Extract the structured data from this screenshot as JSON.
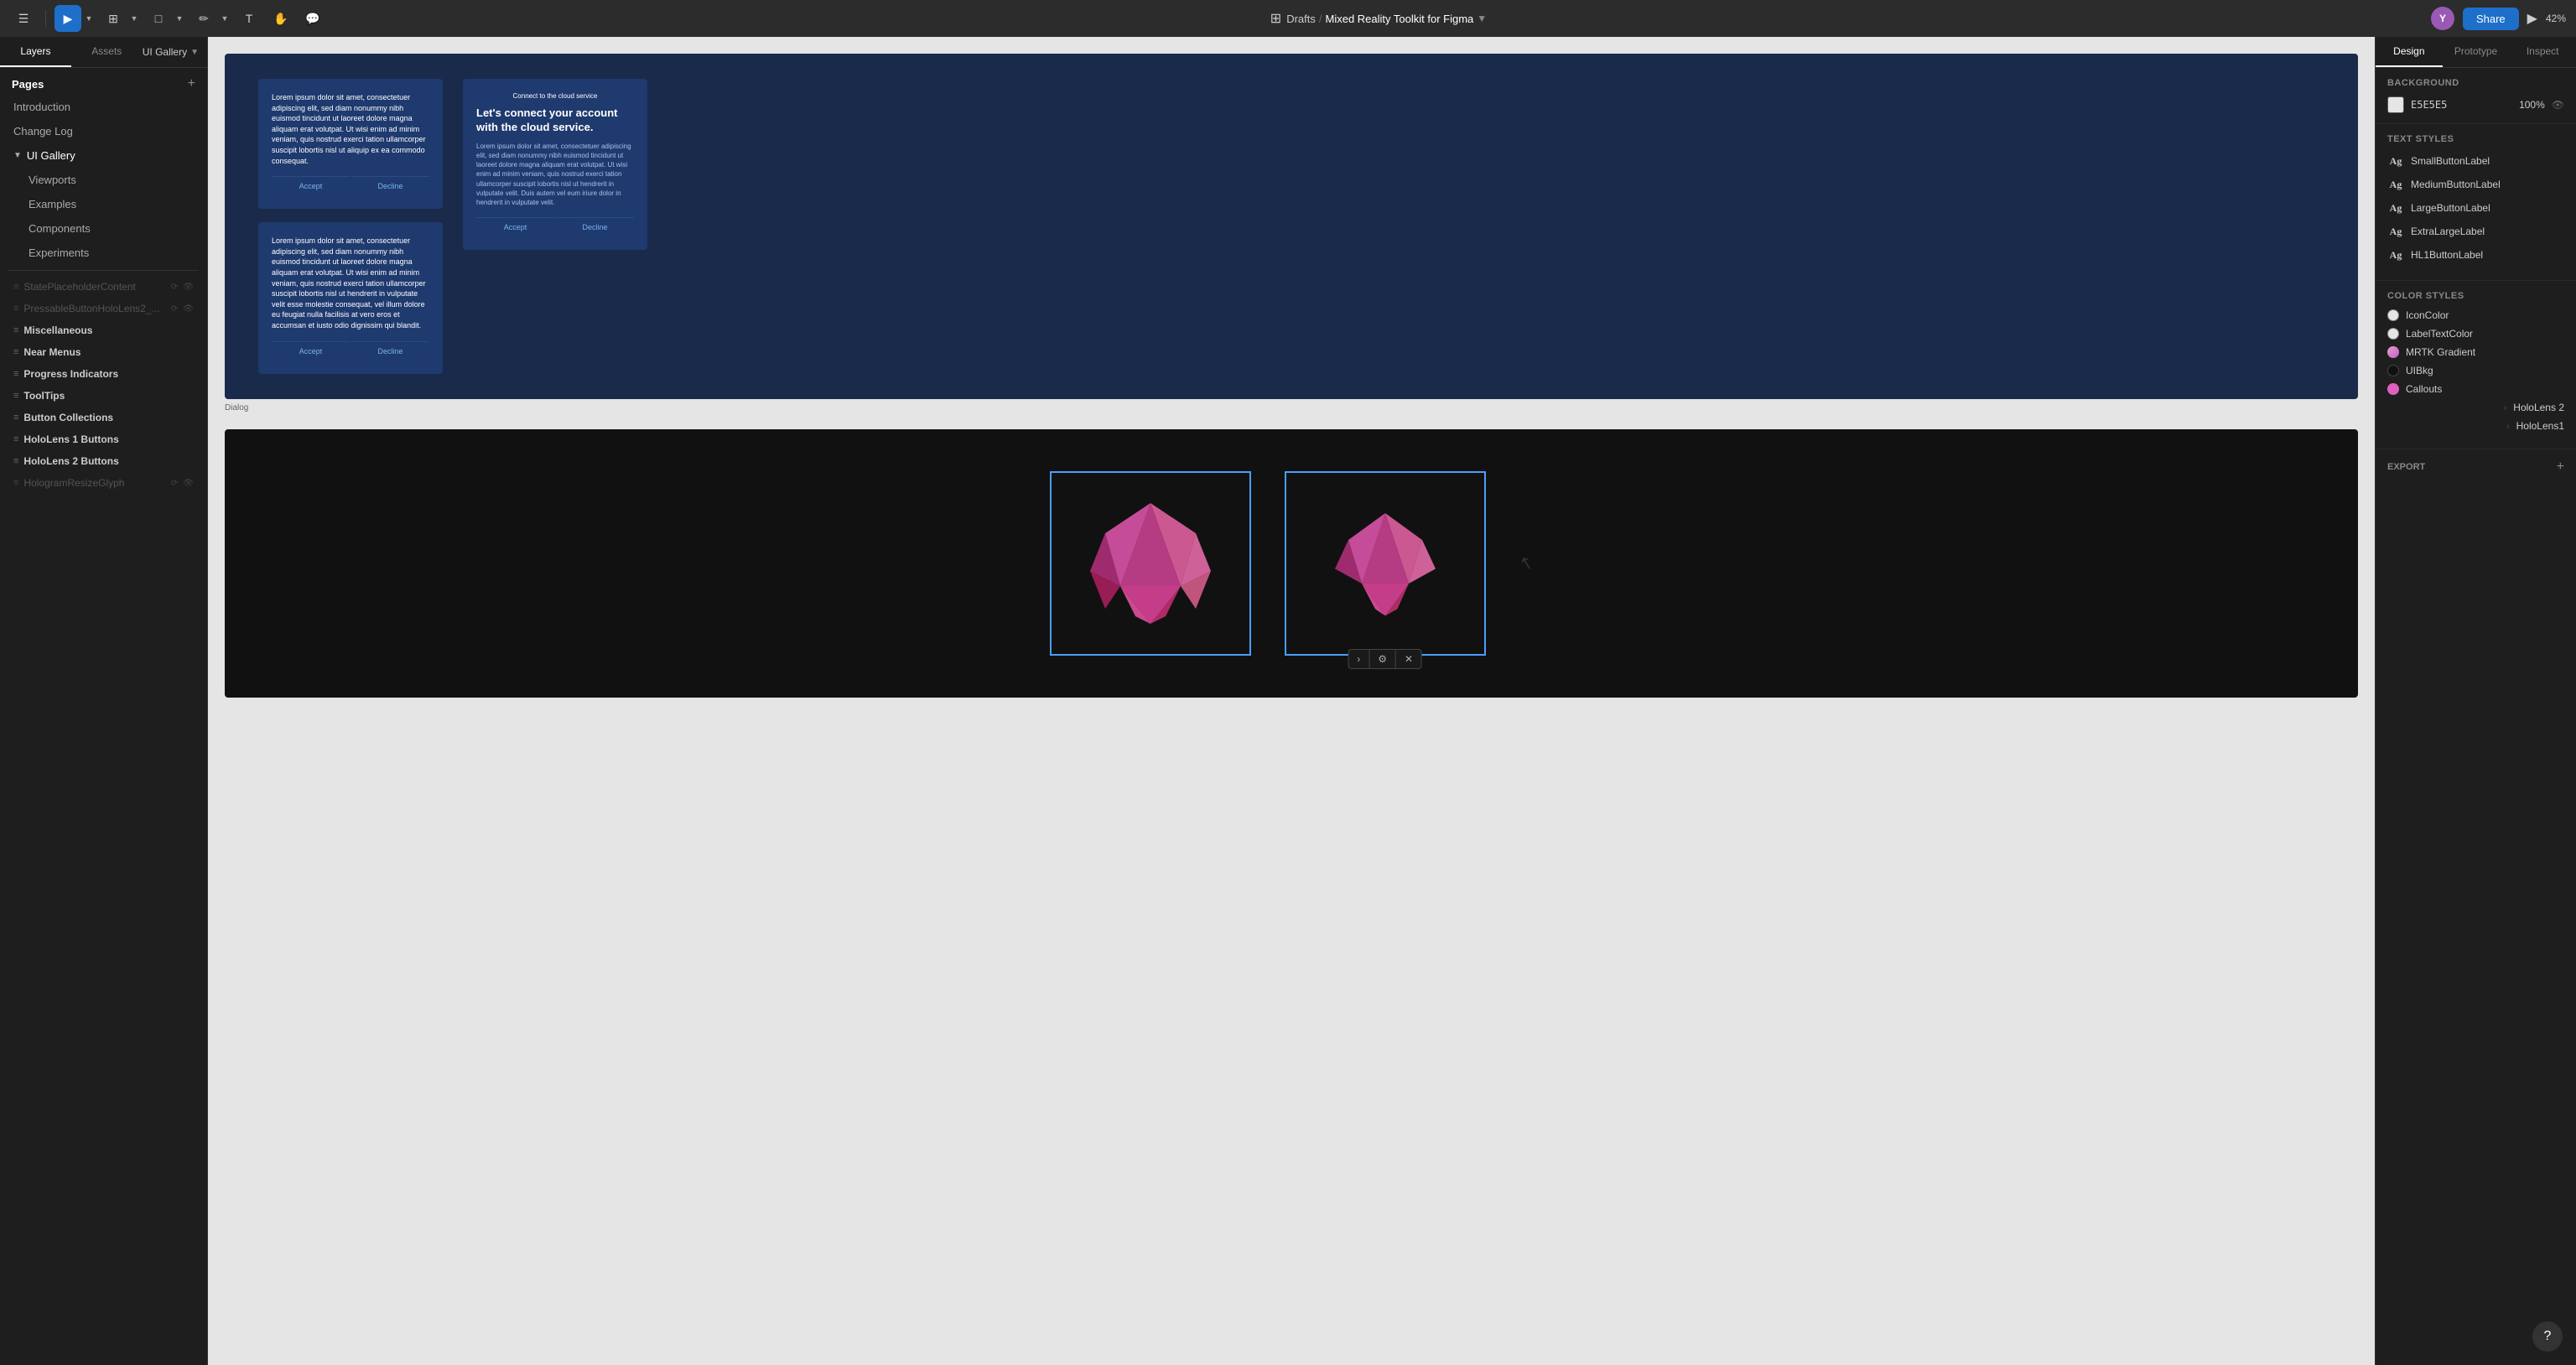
{
  "app": {
    "title": "Mixed Reality Toolkit for Figma",
    "breadcrumb_sep": "/",
    "drafts": "Drafts",
    "zoom": "42%"
  },
  "toolbar": {
    "tools": [
      {
        "id": "menu",
        "icon": "☰",
        "active": false
      },
      {
        "id": "move",
        "icon": "▶",
        "active": true
      },
      {
        "id": "frame",
        "icon": "⊞",
        "active": false
      },
      {
        "id": "shape",
        "icon": "□",
        "active": false
      },
      {
        "id": "pen",
        "icon": "✏",
        "active": false
      },
      {
        "id": "text",
        "icon": "T",
        "active": false
      },
      {
        "id": "hand",
        "icon": "✋",
        "active": false
      },
      {
        "id": "comment",
        "icon": "💬",
        "active": false
      }
    ],
    "grid_icon": "⊞",
    "share_label": "Share",
    "play_icon": "▶",
    "avatar_initials": "Y"
  },
  "left_panel": {
    "tabs": [
      "Layers",
      "Assets"
    ],
    "active_tab": "Layers",
    "gallery_label": "UI Gallery",
    "pages_title": "Pages",
    "pages": [
      {
        "label": "Introduction",
        "active": false
      },
      {
        "label": "Change Log",
        "active": false
      },
      {
        "label": "UI Gallery",
        "active": true,
        "chevron": true
      },
      {
        "label": "Viewports",
        "active": false,
        "indent": true
      },
      {
        "label": "Examples",
        "active": false,
        "indent": true
      },
      {
        "label": "Components",
        "active": false,
        "indent": true
      },
      {
        "label": "Experiments",
        "active": false,
        "indent": true
      }
    ],
    "layers": [
      {
        "label": "StatePlaceholderContent",
        "icon": "≡",
        "faded": true,
        "actions": [
          "⟳",
          "👁"
        ]
      },
      {
        "label": "PressableButtonHoloLens2_...",
        "icon": "≡",
        "faded": true,
        "actions": [
          "⟳",
          "👁"
        ]
      },
      {
        "label": "Miscellaneous",
        "icon": "≡",
        "bold": true
      },
      {
        "label": "Near Menus",
        "icon": "≡",
        "bold": true
      },
      {
        "label": "Progress Indicators",
        "icon": "≡",
        "bold": true
      },
      {
        "label": "ToolTips",
        "icon": "≡",
        "bold": true
      },
      {
        "label": "Button Collections",
        "icon": "≡",
        "bold": true
      },
      {
        "label": "HoloLens 1 Buttons",
        "icon": "≡",
        "bold": true
      },
      {
        "label": "HoloLens 2 Buttons",
        "icon": "≡",
        "bold": true
      },
      {
        "label": "HologramResizeGlyph",
        "icon": "≡",
        "faded": true,
        "actions": [
          "⟳",
          "👁"
        ]
      }
    ]
  },
  "right_panel": {
    "tabs": [
      "Design",
      "Prototype",
      "Inspect"
    ],
    "active_tab": "Design",
    "background_section": {
      "title": "Background",
      "color": "E5E5E5",
      "opacity": "100%"
    },
    "text_styles": {
      "title": "Text Styles",
      "items": [
        {
          "label": "SmallButtonLabel"
        },
        {
          "label": "MediumButtonLabel"
        },
        {
          "label": "LargeButtonLabel"
        },
        {
          "label": "ExtraLargeLabel"
        },
        {
          "label": "HL1ButtonLabel"
        }
      ]
    },
    "color_styles": {
      "title": "Color Styles",
      "items": [
        {
          "label": "IconColor",
          "color": "#e5e5e5",
          "has_chevron": false
        },
        {
          "label": "LabelTextColor",
          "color": "#e5e5e5",
          "has_chevron": false
        },
        {
          "label": "MRTK Gradient",
          "color": "#e8a0b0",
          "has_chevron": false
        },
        {
          "label": "UIBKG",
          "color": "#111111",
          "has_chevron": false
        },
        {
          "label": "Callouts",
          "color": "#e060b0",
          "has_chevron": false
        },
        {
          "label": "HoloLens 2",
          "color": null,
          "has_chevron": true
        },
        {
          "label": "HoloLens1",
          "color": null,
          "has_chevron": true
        }
      ]
    },
    "export": {
      "title": "Export"
    }
  },
  "canvas": {
    "dialog_label": "Dialog",
    "dialog_top_text": "Lorem ipsum dolor sit amet, consectetuer adipiscing elit, sed diam nonummy nibh euismod tincidunt ut laoreet dolore magna aliquam erat volutpat. Ut wisi enim ad minim veniam, quis nostrud exerci tation ullamcorper suscipit lobortis nisl ut aliquip ex ea commodo consequat.",
    "dialog_accept": "Accept",
    "dialog_decline": "Decline",
    "dialog_bottom_text": "Lorem ipsum dolor sit amet, consectetuer adipiscing elit, sed diam nonummy nibh euismod tincidunt ut laoreet dolore magna aliquam erat volutpat. Ut wisi enim ad minim veniam, quis nostrud exerci tation ullamcorper suscipit lobortis nisl ut hendrerit in vulputate velit esse molestie consequat, vel illum dolore eu feugiat nulla facilisis at vero eros et accumsan et iusto odio dignissim qui blandit.",
    "cloud_header": "Connect to the cloud service",
    "cloud_title": "Let's connect your account with the cloud service.",
    "cloud_body": "Lorem ipsum dolor sit amet, consectetuer adipiscing elit, sed diam nonummy nibh euismod tincidunt ut laoreet dolore magna aliquam erat volutpat. Ut wisi enim ad minim veniam, quis nostrud exerci tation ullamcorper suscipit lobortis nisl ut hendrerit in vulputate velit. Duis autem vel eum iriure dolor in hendrerit in vulputate velit.",
    "cloud_accept": "Accept",
    "cloud_decline": "Decline"
  }
}
